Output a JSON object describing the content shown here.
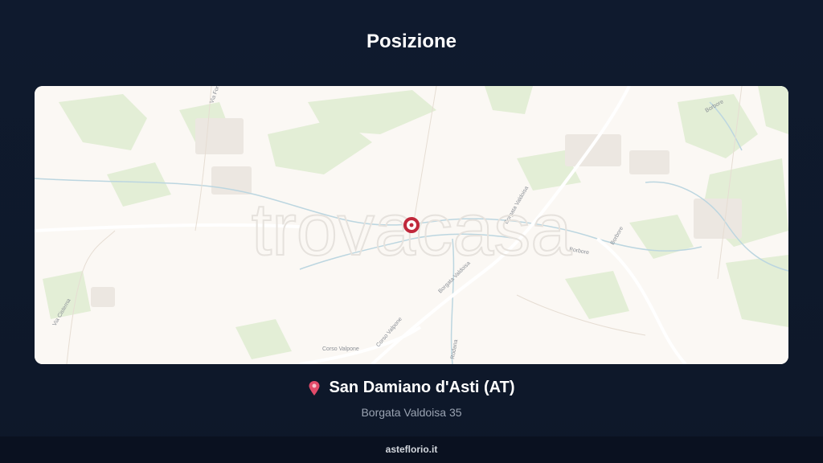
{
  "header": {
    "title": "Posizione"
  },
  "map": {
    "watermark": "trovacasa",
    "road_labels": [
      "Via Fornaci",
      "Borgata Valdoisa",
      "Borgata Valdoisa",
      "Corso Valpone",
      "Corso Valpone",
      "Via Cisterna",
      "Rodana",
      "Borbore",
      "Borbore",
      "Borbore"
    ],
    "marker_icon": "location-marker-icon"
  },
  "location": {
    "pin_icon": "pin-icon",
    "name": "San Damiano d'Asti (AT)",
    "address": "Borgata Valdoisa 35"
  },
  "footer": {
    "site": "asteflorio.it"
  }
}
